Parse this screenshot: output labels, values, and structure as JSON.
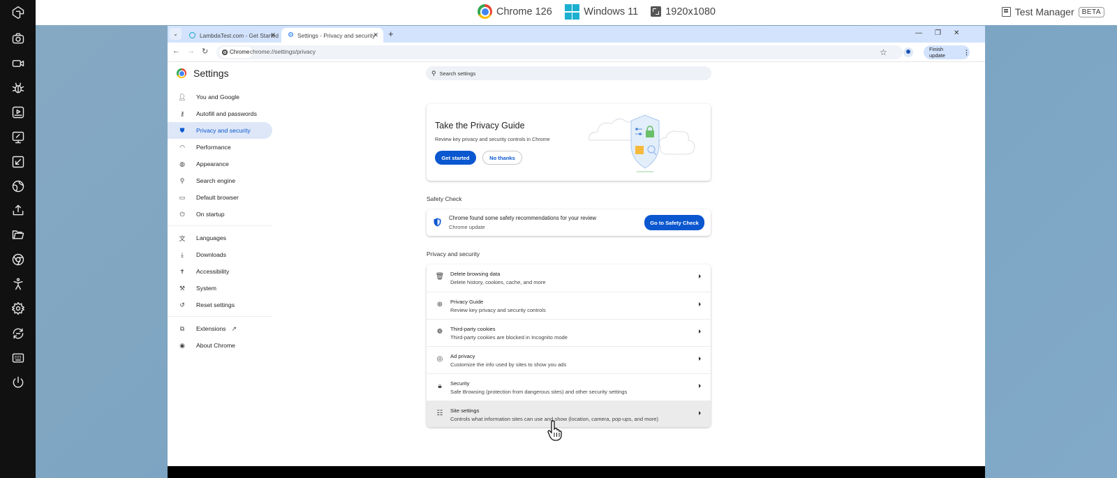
{
  "lambdatest": {
    "sidebar_icons": [
      "lambdatest-logo-icon",
      "camera-icon",
      "video-icon",
      "bug-icon",
      "screen-record-icon",
      "monitor-resize-icon",
      "resize-arrow-icon",
      "globe-icon",
      "upload-icon",
      "folder-icon",
      "chrome-icon",
      "accessibility-icon",
      "settings-icon",
      "switch-icon",
      "keyboard-icon",
      "power-icon"
    ],
    "browser_label": "Chrome 126",
    "os_label": "Windows 11",
    "resolution_label": "1920x1080",
    "test_manager_label": "Test Manager",
    "beta_label": "BETA"
  },
  "browser": {
    "tabs": [
      {
        "title": "LambdaTest.com - Get Started",
        "active": false
      },
      {
        "title": "Settings - Privacy and security",
        "active": true
      }
    ],
    "chip_label": "Chrome",
    "url": "chrome://settings/privacy",
    "finish_update_label": "Finish update"
  },
  "settings": {
    "title": "Settings",
    "search_placeholder": "Search settings",
    "nav": [
      {
        "label": "You and Google",
        "icon": "person-icon"
      },
      {
        "label": "Autofill and passwords",
        "icon": "key-icon"
      },
      {
        "label": "Privacy and security",
        "icon": "shield-icon",
        "active": true
      },
      {
        "label": "Performance",
        "icon": "speedometer-icon"
      },
      {
        "label": "Appearance",
        "icon": "palette-icon"
      },
      {
        "label": "Search engine",
        "icon": "search-icon"
      },
      {
        "label": "Default browser",
        "icon": "browser-window-icon"
      },
      {
        "label": "On startup",
        "icon": "power-icon"
      },
      {
        "label": "Languages",
        "icon": "translate-icon"
      },
      {
        "label": "Downloads",
        "icon": "download-icon"
      },
      {
        "label": "Accessibility",
        "icon": "accessibility-icon"
      },
      {
        "label": "System",
        "icon": "wrench-icon"
      },
      {
        "label": "Reset settings",
        "icon": "reset-icon"
      },
      {
        "label": "Extensions",
        "icon": "puzzle-icon"
      },
      {
        "label": "About Chrome",
        "icon": "chrome-icon"
      }
    ],
    "privacy_guide_card": {
      "title": "Take the Privacy Guide",
      "subtitle": "Review key privacy and security controls in Chrome",
      "primary_button": "Get started",
      "secondary_button": "No thanks"
    },
    "safety_check": {
      "section_label": "Safety Check",
      "message": "Chrome found some safety recommendations for your review",
      "detail": "Chrome update",
      "button": "Go to Safety Check"
    },
    "privacy_section": {
      "section_label": "Privacy and security",
      "rows": [
        {
          "title": "Delete browsing data",
          "subtitle": "Delete history, cookies, cache, and more",
          "icon": "trash-icon"
        },
        {
          "title": "Privacy Guide",
          "subtitle": "Review key privacy and security controls",
          "icon": "compass-plus-icon"
        },
        {
          "title": "Third-party cookies",
          "subtitle": "Third-party cookies are blocked in Incognito mode",
          "icon": "cookie-icon"
        },
        {
          "title": "Ad privacy",
          "subtitle": "Customize the info used by sites to show you ads",
          "icon": "ad-privacy-icon"
        },
        {
          "title": "Security",
          "subtitle": "Safe Browsing (protection from dangerous sites) and other security settings",
          "icon": "lock-icon"
        },
        {
          "title": "Site settings",
          "subtitle": "Controls what information sites can use and show (location, camera, pop-ups, and more)",
          "icon": "sliders-icon",
          "hovered": true
        }
      ]
    }
  },
  "colors": {
    "accent": "#0b57d0",
    "tabstrip": "#d3e3fd",
    "active_nav_bg": "#dde7f8",
    "lt_sidebar": "#111111"
  }
}
